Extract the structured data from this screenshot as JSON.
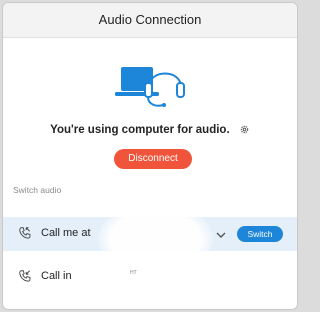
{
  "window": {
    "title": "Audio Connection"
  },
  "status": {
    "text": "You're using computer for audio."
  },
  "actions": {
    "disconnect_label": "Disconnect"
  },
  "switch_audio": {
    "section_label": "Switch audio",
    "call_me": {
      "label": "Call me at",
      "switch_label": "Switch"
    },
    "call_in": {
      "label": "Call in",
      "extra": "ᴴᵀ"
    }
  },
  "colors": {
    "accent_blue": "#1e86d8",
    "disconnect_red": "#f0553b",
    "selected_row": "#e4effa"
  },
  "icons": [
    "computer-headset-icon",
    "gear-icon",
    "phone-callback-icon",
    "chevron-down-icon",
    "phone-call-in-icon"
  ]
}
